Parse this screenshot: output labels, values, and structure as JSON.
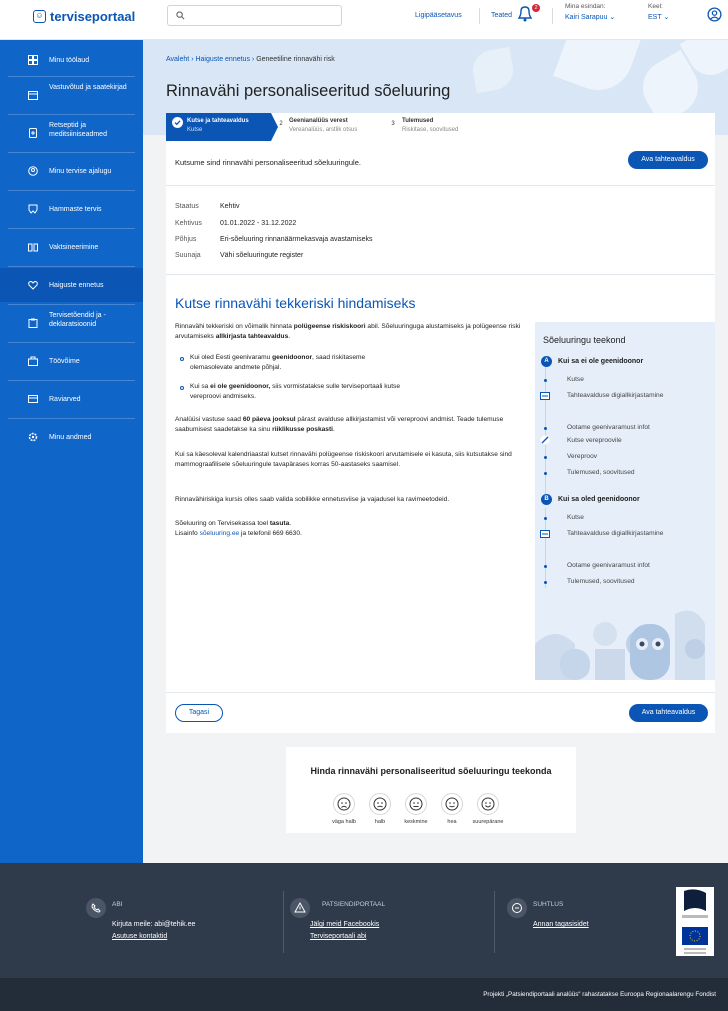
{
  "header": {
    "logo_text": "terviseportaal",
    "search_placeholder": "",
    "accessibility": "Ligipääsetavus",
    "notifications": "Teated",
    "notification_count": "2",
    "representing_label": "Mina esindan:",
    "representing_value": "Kairi Sarapuu",
    "language_label": "Keel:",
    "language_value": "EST"
  },
  "sidebar": {
    "items": [
      {
        "label": "Minu töölaud",
        "icon": "dashboard-icon"
      },
      {
        "label": "Vastuvõtud ja saatekirjad",
        "icon": "calendar-icon"
      },
      {
        "label": "Retseptid ja meditsiiniseadmed",
        "icon": "pill-icon"
      },
      {
        "label": "Minu tervise ajalugu",
        "icon": "history-icon"
      },
      {
        "label": "Hammaste tervis",
        "icon": "tooth-icon"
      },
      {
        "label": "Vaktsineerimine",
        "icon": "syringe-icon"
      },
      {
        "label": "Haiguste ennetus",
        "icon": "heart-pulse-icon"
      },
      {
        "label": "Tervisetõendid ja -deklaratsioonid",
        "icon": "clipboard-icon"
      },
      {
        "label": "Töövõime",
        "icon": "briefcase-icon"
      },
      {
        "label": "Raviarved",
        "icon": "invoice-icon"
      },
      {
        "label": "Minu andmed",
        "icon": "settings-icon"
      }
    ]
  },
  "breadcrumb": {
    "home": "Avaleht",
    "section": "Haiguste ennetus",
    "current": "Geneetiline rinnavähi risk"
  },
  "page_title": "Rinnavähi personaliseeritud sõeluuring",
  "steps": [
    {
      "num": "1",
      "title": "Kutse ja tahteavaldus",
      "sub": "Kutse"
    },
    {
      "num": "2",
      "title": "Geenianalüüs verest",
      "sub": "Vereanalüüs, arstlik otsus"
    },
    {
      "num": "3",
      "title": "Tulemused",
      "sub": "Riskitase, soovitused"
    }
  ],
  "invite": {
    "text": "Kutsume sind rinnavähi personaliseeritud sõeluuringule.",
    "button": "Ava tahteavaldus"
  },
  "details": [
    {
      "label": "Staatus",
      "value": "Kehtiv"
    },
    {
      "label": "Kehtivus",
      "value": "01.01.2022 - 31.12.2022"
    },
    {
      "label": "Põhjus",
      "value": "Eri-sõeluuring rinnanäärmekasvaja avastamiseks"
    },
    {
      "label": "Suunaja",
      "value": "Vähi sõeluuringute register"
    }
  ],
  "section_title": "Kutse rinnavähi tekkeriski hindamiseks",
  "paragraphs": {
    "p1_a": "Rinnavähi tekkeriski on võimalik hinnata ",
    "p1_b": "polügeense riskiskoori",
    "p1_c": " abil. Sõeluuringuga alustamiseks ja polügeense riski arvutamiseks ",
    "p1_d": "allkirjasta tahteavaldus",
    "p1_e": ".",
    "b1_a": "Kui oled Eesti geenivaramu ",
    "b1_b": "geenidoonor",
    "b1_c": ", saad riskitaseme olemasolevate andmete põhjal.",
    "b2_a": "Kui sa ",
    "b2_b": "ei ole geenidoonor,",
    "b2_c": " siis vormistatakse sulle terviseportaali kutse vereproovi andmiseks.",
    "p2_a": "Analüüsi vastuse saad ",
    "p2_b": "60 päeva jooksul",
    "p2_c": " pärast avalduse allkirjastamist või vereproovi andmist. Teade tulemuse saabumisest saadetakse ka sinu ",
    "p2_d": "riiklikusse poskasti",
    "p2_e": ".",
    "p3": "Kui sa käesoleval kalendriaastal kutset rinnavähi polügeense riskiskoori arvutamisele ei kasuta, siis kutsutakse sind mammograafilisele sõeluuringule tavapärases korras 50-aastaseks saamisel.",
    "p4": "Rinnavähiriskiga kursis olles saab valida sobilikke ennetusviise ja vajadusel ka ravimeetodeid.",
    "p5_a": "Sõeluuring on Tervisekassa toel ",
    "p5_b": "tasuta",
    "p5_c": ".",
    "p6_a": "Lisainfo ",
    "p6_link": "sõeluuring.ee",
    "p6_b": " ja telefonil 669 6630."
  },
  "path_panel": {
    "title": "Sõeluuringu teekond",
    "groupA": {
      "badge": "A",
      "title": "Kui sa ei ole geenidoonor",
      "items": [
        "Kutse",
        "Tahteavalduse digiallkirjastamine",
        "Ootame geenivaramust infot",
        "Kutse vereproovile",
        "Vereproov",
        "Tulemused, soovitused"
      ]
    },
    "groupB": {
      "badge": "B",
      "title": "Kui sa oled geenidoonor",
      "items": [
        "Kutse",
        "Tahteavalduse digiallkirjastamine",
        "Ootame geenivaramust infot",
        "Tulemused, soovitused"
      ]
    }
  },
  "buttons": {
    "back": "Tagasi",
    "open": "Ava tahteavaldus"
  },
  "rating": {
    "title": "Hinda rinnavähi personaliseeritud sõeluuringu teekonda",
    "options": [
      "väga halb",
      "halb",
      "keskmine",
      "hea",
      "suurepärane"
    ]
  },
  "footer": {
    "abi_title": "ABI",
    "abi_email_label": "Kirjuta meile: abi@tehik.ee",
    "abi_contacts": "Asutuse kontaktid",
    "portal_title": "PATSIENDIPORTAAL",
    "portal_fb": "Jälgi meid Facebookis",
    "portal_help": "Terviseportaali abi",
    "contact_title": "SUHTLUS",
    "contact_feedback": "Annan tagasisidet",
    "project": "Projekti „Patsiendiportaali analüüs“ rahastatakse Euroopa Regionaalarengu Fondist"
  },
  "colors": {
    "primary": "#0b55b4",
    "sidebar": "#1065c8",
    "footer": "#2f3b4b",
    "hero": "#d8e6f5"
  }
}
